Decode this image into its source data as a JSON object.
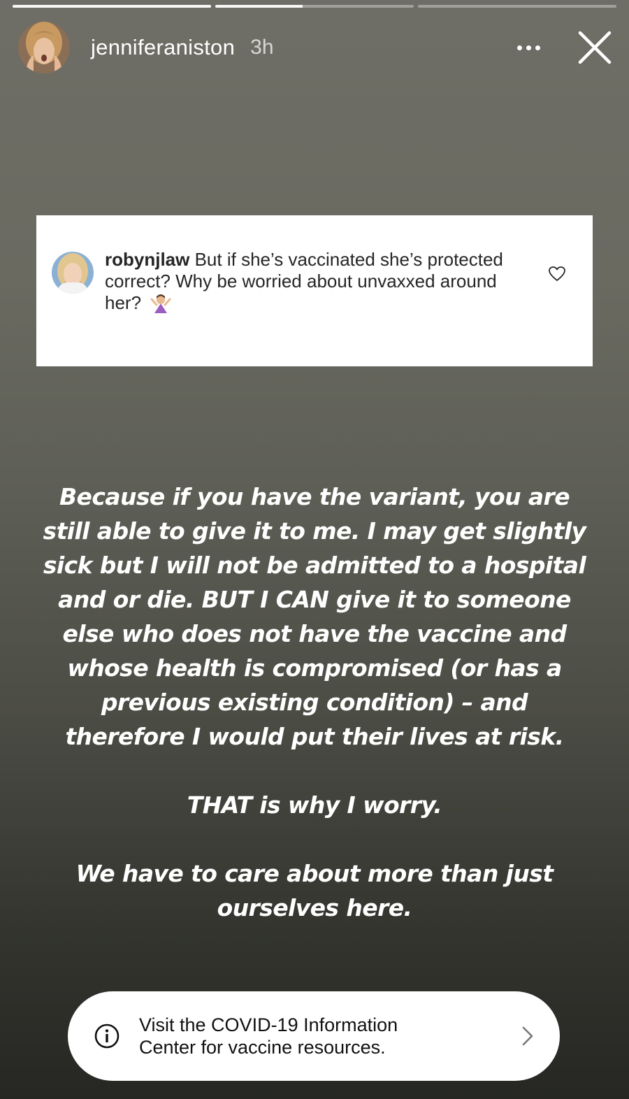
{
  "story": {
    "progress": [
      1.0,
      0.44,
      0.0
    ]
  },
  "header": {
    "username": "jenniferaniston",
    "time": "3h",
    "more_icon": "more-horizontal-icon",
    "close_icon": "close-icon"
  },
  "comment": {
    "username": "robynjlaw",
    "text_line1": "But if she’s vaccinated she’s protected",
    "text_line2": "correct? Why be worried about unvaxxed around",
    "text_line3": "her?",
    "emoji": "🤷‍♀️",
    "like_icon": "heart-outline-icon"
  },
  "message": {
    "lines": [
      "Because if you have the variant, you are",
      "still able to give it to me. I may get slightly",
      "sick but I will not be admitted to a hospital",
      "and or die. BUT I CAN give it to someone",
      "else who does not have the vaccine and",
      "whose health is compromised (or has a",
      "previous existing condition) – and",
      "therefore I would put their lives at risk."
    ],
    "line2": "THAT is why I worry.",
    "line3a": "We have to care about more than just",
    "line3b": "ourselves here."
  },
  "info_banner": {
    "line1": "Visit the COVID-19 Information",
    "line2": "Center for vaccine resources.",
    "icon": "info-icon",
    "arrow_icon": "chevron-right-icon"
  }
}
